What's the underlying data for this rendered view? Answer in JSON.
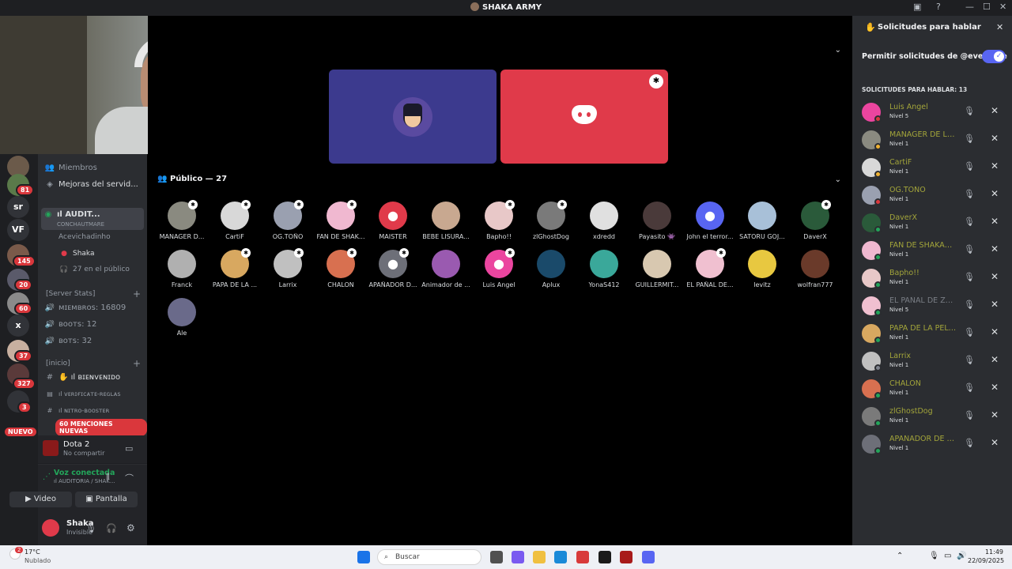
{
  "window": {
    "title": "SHAKA ARMY"
  },
  "guilds": {
    "items": [
      {
        "label": "",
        "badge": ""
      },
      {
        "label": "",
        "badge": "81"
      },
      {
        "label": "sr",
        "badge": ""
      },
      {
        "label": "VF",
        "badge": ""
      },
      {
        "label": "",
        "badge": "145"
      },
      {
        "label": "",
        "badge": "20"
      },
      {
        "label": "",
        "badge": "60"
      },
      {
        "label": "x",
        "badge": ""
      },
      {
        "label": "",
        "badge": "37"
      },
      {
        "label": "",
        "badge": "327"
      },
      {
        "label": "",
        "badge": "3"
      }
    ],
    "new_label": "NUEVO"
  },
  "sidebar": {
    "members": "Miembros",
    "boosts": "Mejoras del servid...",
    "voice_channel": "ıl AUDIT...",
    "voice_subtitle": "CONCHAUTMARE",
    "voice_users": [
      "Acevichadinho",
      "Shaka",
      "27 en el público"
    ],
    "cat_stats": "[Server Stats]",
    "stats": [
      "ᴍɪᴇᴍʙʀᴏs: 16809",
      "ʙᴏᴏᴛs: 12",
      "ʙᴏᴛs: 32"
    ],
    "cat_inicio": "[inicio]",
    "text_channels": [
      "✋ ıl ʙɪᴇɴᴠᴇɴɪᴅᴏ",
      "ıl ᴠᴇʀɪғɪᴄᴀᴛᴇ-ʀᴇɢʟᴀs",
      "ıl ɴɪᴛʀᴏ-ʙᴏᴏsᴛᴇʀ"
    ],
    "mentions": "60 MENCIONES NUEVAS"
  },
  "activity": {
    "game": "Dota 2",
    "status": "No compartir"
  },
  "voice": {
    "status": "Voz conectada",
    "channel": "ıl AUDITORIA / SHAK...",
    "video_label": "Video",
    "screen_label": "Pantalla"
  },
  "user": {
    "name": "Shaka",
    "status": "Invisible"
  },
  "stage": {
    "public_header": "Público — 27",
    "members": [
      "MANAGER D...",
      "CartiF",
      "OG.TOÑO",
      "FAN DE SHAK...",
      "MAISTER",
      "BEBE LISURA...",
      "Bapho!!",
      "zlGhostDog",
      "xdredd",
      "Payasito 👾",
      "John el terror...",
      "SATORU GOJ...",
      "DaverX",
      "Franck",
      "PAPA DE LA ...",
      "Larrix",
      "CHALON",
      "APAÑADOR D...",
      "Animador de ...",
      "Luis Angel",
      "Aplux",
      "YonaS412",
      "GUILLERMIT...",
      "EL PAÑAL DE...",
      "levitz",
      "wolfran777",
      "Ale"
    ]
  },
  "requests": {
    "title": "Solicitudes para hablar",
    "allow_label": "Permitir solicitudes de @everyone",
    "count_label": "SOLICITUDES PARA HABLAR: 13",
    "items": [
      {
        "name": "Luis Angel",
        "level": "Nivel 5"
      },
      {
        "name": "MANAGER DE LA ...",
        "level": "Nivel 1"
      },
      {
        "name": "CartiF",
        "level": "Nivel 1"
      },
      {
        "name": "OG.TOÑO",
        "level": "Nivel 1"
      },
      {
        "name": "DaverX",
        "level": "Nivel 1"
      },
      {
        "name": "FAN DE SHAKAD...",
        "level": "Nivel 1"
      },
      {
        "name": "Bapho!!",
        "level": "Nivel 1"
      },
      {
        "name": "EL PAÑAL DE ZUL...",
        "level": "Nivel 5"
      },
      {
        "name": "PAPA DE LA PELI...",
        "level": "Nivel 1"
      },
      {
        "name": "Larrix",
        "level": "Nivel 1"
      },
      {
        "name": "CHALON",
        "level": "Nivel 1"
      },
      {
        "name": "zlGhostDog",
        "level": "Nivel 1"
      },
      {
        "name": "APAÑADOR DE L...",
        "level": "Nivel 1"
      }
    ]
  },
  "taskbar": {
    "weather_temp": "17°C",
    "weather_desc": "Nublado",
    "weather_badge": "2",
    "search_placeholder": "Buscar",
    "time": "11:49",
    "date": "22/09/2025"
  }
}
